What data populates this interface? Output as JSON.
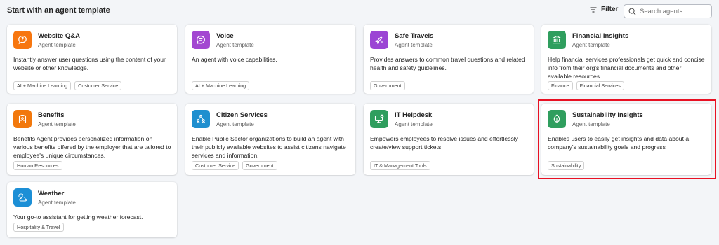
{
  "header": {
    "title": "Start with an agent template",
    "filter_label": "Filter",
    "search_placeholder": "Search agents"
  },
  "cards": [
    {
      "title": "Website Q&A",
      "subtitle": "Agent template",
      "description": "Instantly answer user questions using the content of your website or other knowledge.",
      "tags": [
        "AI + Machine Learning",
        "Customer Service"
      ],
      "icon": "chat-question-icon",
      "icon_color": "#f7760f"
    },
    {
      "title": "Voice",
      "subtitle": "Agent template",
      "description": "An agent with voice capabilities.",
      "tags": [
        "AI + Machine Learning"
      ],
      "icon": "voice-chat-icon",
      "icon_color": "#a347d1"
    },
    {
      "title": "Safe Travels",
      "subtitle": "Agent template",
      "description": "Provides answers to common travel questions and related health and safety guidelines.",
      "tags": [
        "Government"
      ],
      "icon": "airplane-icon",
      "icon_color": "#9b45d4"
    },
    {
      "title": "Financial Insights",
      "subtitle": "Agent template",
      "description": "Help financial services professionals get quick and concise info from their org's financial documents and other available resources.",
      "tags": [
        "Finance",
        "Financial Services"
      ],
      "icon": "bank-icon",
      "icon_color": "#2f9e5e"
    },
    {
      "title": "Benefits",
      "subtitle": "Agent template",
      "description": "Benefits Agent provides personalized information on various benefits offered by the employer that are tailored to employee's unique circumstances.",
      "tags": [
        "Human Resources"
      ],
      "icon": "clipboard-person-icon",
      "icon_color": "#f2780c"
    },
    {
      "title": "Citizen Services",
      "subtitle": "Agent template",
      "description": "Enable Public Sector organizations to build an agent with their publicly available websites to assist citizens navigate services and information.",
      "tags": [
        "Customer Service",
        "Government"
      ],
      "icon": "people-network-icon",
      "icon_color": "#1f8fcf"
    },
    {
      "title": "IT Helpdesk",
      "subtitle": "Agent template",
      "description": "Empowers employees to resolve issues and effortlessly create/view support tickets.",
      "tags": [
        "IT & Management Tools"
      ],
      "icon": "desktop-check-icon",
      "icon_color": "#2f9e5e"
    },
    {
      "title": "Sustainability Insights",
      "subtitle": "Agent template",
      "description": "Enables users to easily get insights and data about a company's sustainability goals and progress",
      "tags": [
        "Sustainability"
      ],
      "icon": "leaf-icon",
      "icon_color": "#2f9e5e"
    },
    {
      "title": "Weather",
      "subtitle": "Agent template",
      "description": "Your go-to assistant for getting weather forecast.",
      "tags": [
        "Hospitality & Travel"
      ],
      "icon": "sun-cloud-icon",
      "icon_color": "#1c8fd6"
    }
  ]
}
